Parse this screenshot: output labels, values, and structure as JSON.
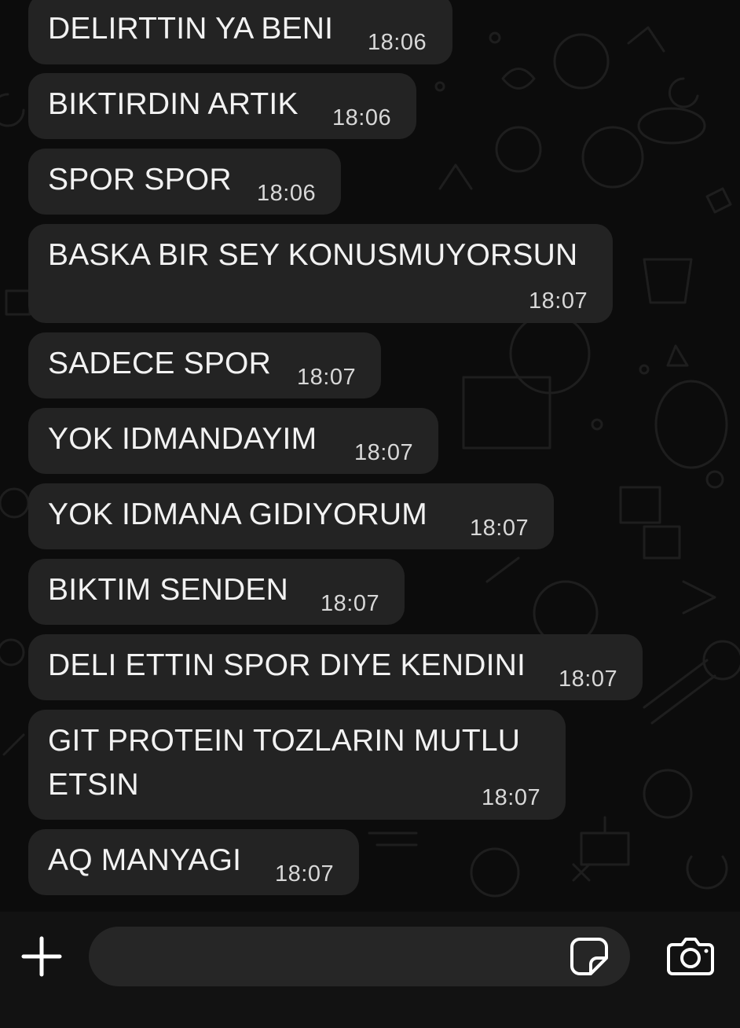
{
  "messages": [
    {
      "text": "DELIRTTIN YA BENI",
      "time": "18:06"
    },
    {
      "text": "BIKTIRDIN ARTIK",
      "time": "18:06"
    },
    {
      "text": "SPOR SPOR",
      "time": "18:06"
    },
    {
      "text": "BASKA BIR SEY KONUSMUYORSUN",
      "time": "18:07"
    },
    {
      "text": "SADECE SPOR",
      "time": "18:07"
    },
    {
      "text": "YOK IDMANDAYIM",
      "time": "18:07"
    },
    {
      "text": "YOK IDMANA GIDIYORUM",
      "time": "18:07"
    },
    {
      "text": "BIKTIM SENDEN",
      "time": "18:07"
    },
    {
      "text": "DELI ETTIN SPOR DIYE KENDINI",
      "time": "18:07"
    },
    {
      "text": "GIT PROTEIN TOZLARIN MUTLU",
      "text2": "ETSIN",
      "time": "18:07"
    },
    {
      "text": "AQ MANYAGI",
      "time": "18:07"
    }
  ],
  "composer": {
    "input_value": "",
    "icons": {
      "attach": "plus-icon",
      "sticker": "sticker-icon",
      "camera": "camera-icon"
    }
  },
  "colors": {
    "background": "#0c0c0c",
    "bubble": "#232323",
    "text": "#f2f2f2",
    "composer_bar": "#121212",
    "composer_input": "#262626"
  }
}
